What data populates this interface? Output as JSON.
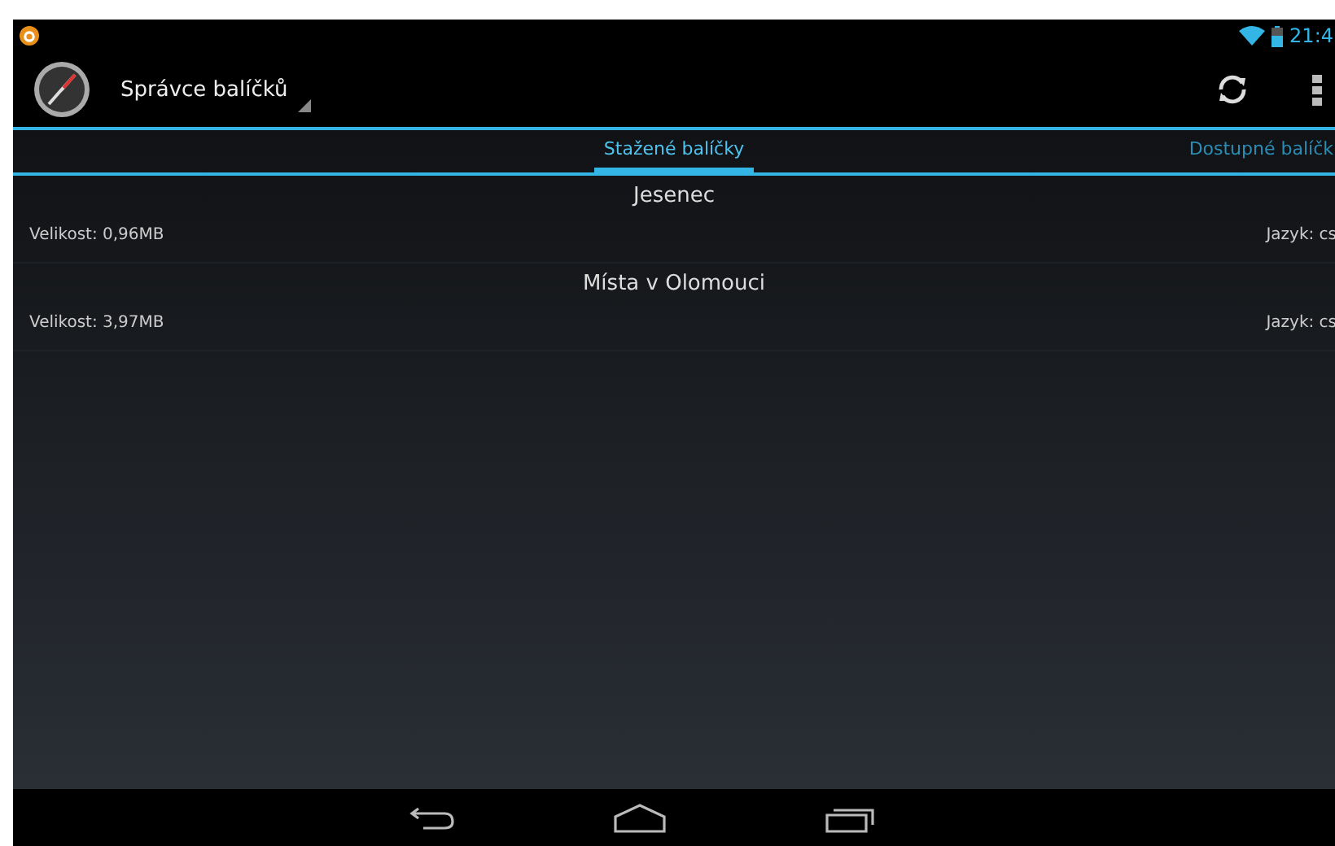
{
  "status_bar": {
    "time": "21:4"
  },
  "action_bar": {
    "title": "Správce balíčků"
  },
  "tabs": [
    {
      "label": "Stažené balíčky",
      "selected": true
    },
    {
      "label": "Dostupné balíčk",
      "selected": false
    }
  ],
  "packages": [
    {
      "name": "Jesenec",
      "size": "Velikost: 0,96MB",
      "language": "Jazyk: cs"
    },
    {
      "name": "Místa v Olomouci",
      "size": "Velikost: 3,97MB",
      "language": "Jazyk: cs"
    }
  ]
}
